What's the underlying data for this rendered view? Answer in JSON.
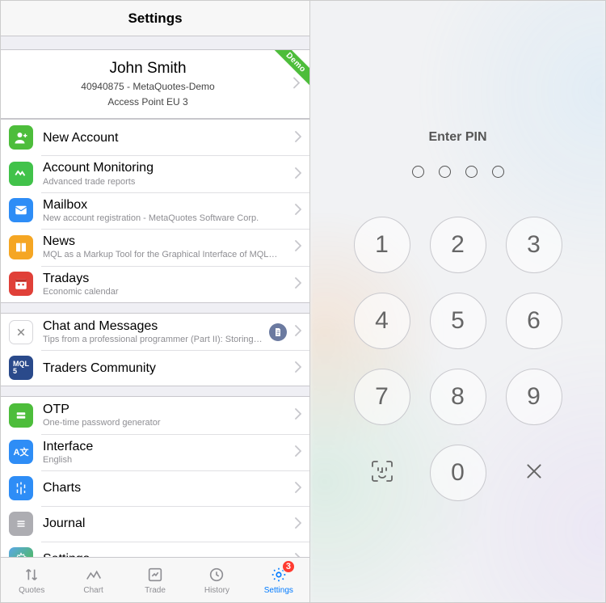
{
  "header": {
    "title": "Settings"
  },
  "account": {
    "name": "John Smith",
    "line1": "40940875 - MetaQuotes-Demo",
    "line2": "Access Point EU 3",
    "ribbon": "Demo"
  },
  "section1": [
    {
      "icon": "user-plus-icon",
      "color": "bg-green",
      "title": "New Account",
      "subtitle": ""
    },
    {
      "icon": "monitor-icon",
      "color": "bg-green2",
      "title": "Account Monitoring",
      "subtitle": "Advanced trade reports"
    },
    {
      "icon": "mail-icon",
      "color": "bg-blue",
      "title": "Mailbox",
      "subtitle": "New account registration - MetaQuotes Software Corp."
    },
    {
      "icon": "book-icon",
      "color": "bg-orange",
      "title": "News",
      "subtitle": "MQL as a Markup Tool for the Graphical Interface of MQL…"
    },
    {
      "icon": "calendar-icon",
      "color": "bg-red",
      "title": "Tradays",
      "subtitle": "Economic calendar"
    }
  ],
  "section2": [
    {
      "icon": "chat-icon",
      "color": "bg-white",
      "title": "Chat and Messages",
      "subtitle": "Tips from a professional programmer (Part II): Storing…",
      "accessory": "doc-badge-icon"
    },
    {
      "icon": "mql5-icon",
      "color": "bg-navy",
      "title": "Traders Community",
      "subtitle": ""
    }
  ],
  "section3": [
    {
      "icon": "otp-icon",
      "color": "bg-lime",
      "title": "OTP",
      "subtitle": "One-time password generator"
    },
    {
      "icon": "language-icon",
      "color": "bg-blue2",
      "title": "Interface",
      "subtitle": "English"
    },
    {
      "icon": "chart-icon",
      "color": "bg-blue3",
      "title": "Charts",
      "subtitle": ""
    },
    {
      "icon": "journal-icon",
      "color": "bg-gray",
      "title": "Journal",
      "subtitle": ""
    },
    {
      "icon": "gear-icon",
      "color": "bg-multi",
      "title": "Settings",
      "subtitle": ""
    }
  ],
  "tabs": [
    {
      "icon": "quotes-icon",
      "label": "Quotes"
    },
    {
      "icon": "chart-tab-icon",
      "label": "Chart"
    },
    {
      "icon": "trade-icon",
      "label": "Trade"
    },
    {
      "icon": "history-icon",
      "label": "History"
    },
    {
      "icon": "settings-tab-icon",
      "label": "Settings",
      "active": true,
      "badge": "3"
    }
  ],
  "pin": {
    "title": "Enter PIN",
    "dot_count": 4,
    "keys": [
      "1",
      "2",
      "3",
      "4",
      "5",
      "6",
      "7",
      "8",
      "9"
    ],
    "zero": "0"
  }
}
